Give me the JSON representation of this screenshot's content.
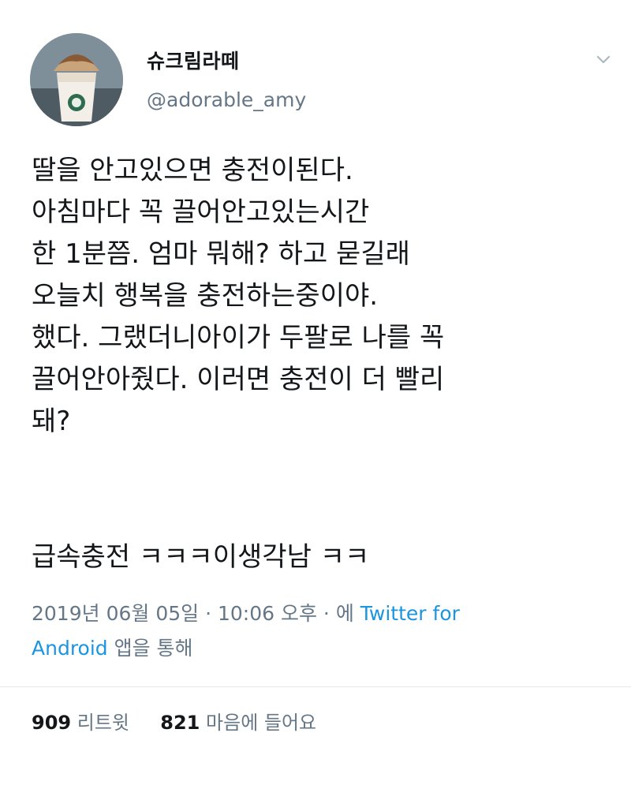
{
  "user": {
    "display_name": "슈크림라떼",
    "handle": "@adorable_amy",
    "avatar_icon": "profile-photo-frappuccino"
  },
  "menu_icon": "chevron-down-icon",
  "tweet": {
    "text": "딸을 안고있으면 충전이된다.\n아침마다 꼭 끌어안고있는시간\n한 1분쯤. 엄마 뭐해? 하고 묻길래\n오늘치 행복을 충전하는중이야.\n했다. 그랬더니아이가 두팔로 나를 꼭\n끌어안아줬다. 이러면 충전이 더 빨리\n돼?",
    "tail": "급속충전 ㅋㅋㅋ이생각남 ㅋㅋ"
  },
  "meta": {
    "timestamp": "2019년 06월 05일 · 10:06 오후 · 에",
    "source_line1": "Twitter for",
    "source_line2": "Android",
    "suffix": "앱을 통해"
  },
  "stats": {
    "retweets_count": "909",
    "retweets_label": "리트윗",
    "likes_count": "821",
    "likes_label": "마음에 들어요"
  },
  "colors": {
    "text": "#14171a",
    "secondary": "#657786",
    "link": "#1b95e0",
    "divider": "#e1e8ed"
  }
}
